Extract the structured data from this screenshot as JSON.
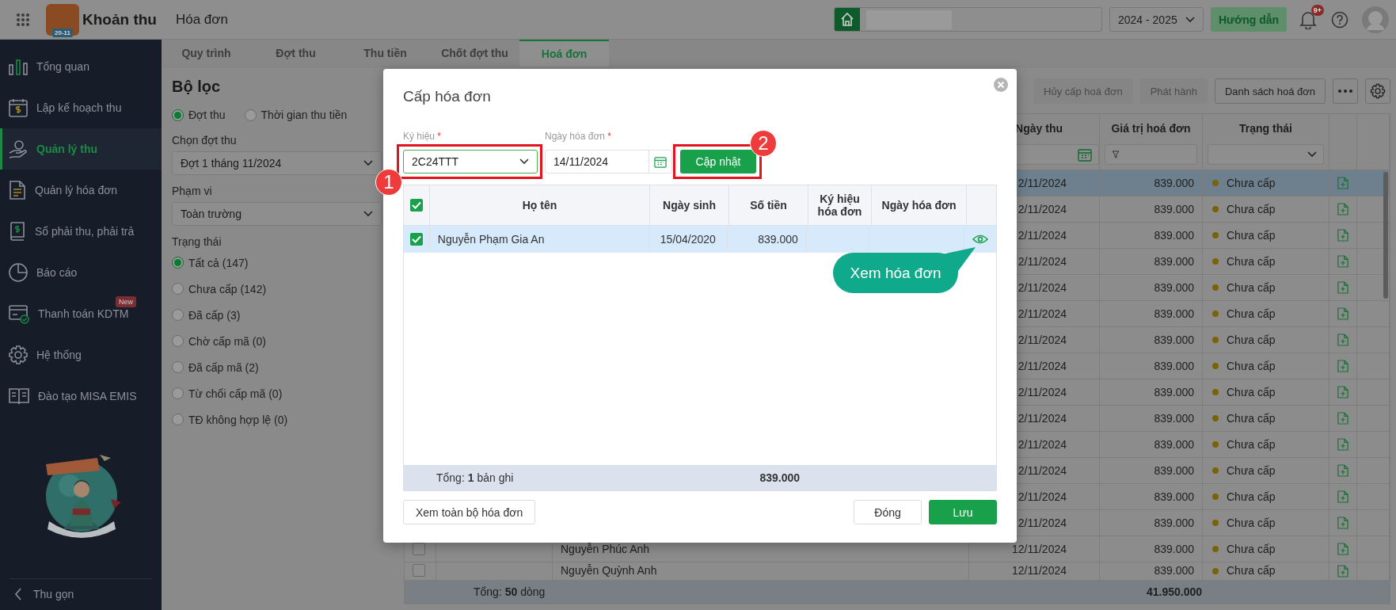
{
  "top_bar": {
    "logo_badge": "20-11",
    "app_name": "Khoản thu",
    "page_title": "Hóa đơn",
    "school_year": "2024 - 2025",
    "guide_button": "Hướng dẫn",
    "notification_badge": "9+"
  },
  "sidebar": {
    "items": [
      {
        "label": "Tổng quan",
        "selected": false
      },
      {
        "label": "Lập kế hoạch thu",
        "selected": false
      },
      {
        "label": "Quản lý thu",
        "selected": true
      },
      {
        "label": "Quản lý hóa đơn",
        "selected": false
      },
      {
        "label": "Sổ phải thu, phải trả",
        "selected": false
      },
      {
        "label": "Báo cáo",
        "selected": false
      },
      {
        "label": "Thanh toán KDTM",
        "selected": false,
        "badge": "New"
      },
      {
        "label": "Hệ thống",
        "selected": false
      },
      {
        "label": "Đào tạo MISA EMIS",
        "selected": false
      }
    ],
    "collapse": "Thu gọn"
  },
  "tabs": [
    {
      "label": "Quy trình",
      "selected": false
    },
    {
      "label": "Đợt thu",
      "selected": false
    },
    {
      "label": "Thu tiền",
      "selected": false
    },
    {
      "label": "Chốt đợt thu",
      "selected": false
    },
    {
      "label": "Hoá đơn",
      "selected": true
    }
  ],
  "filter": {
    "title": "Bộ lọc",
    "mode_options": [
      {
        "label": "Đợt thu",
        "selected": true
      },
      {
        "label": "Thời gian thu tiền",
        "selected": false
      }
    ],
    "period_label": "Chọn đợt thu",
    "period_value": "Đợt 1 tháng 11/2024",
    "scope_label": "Phạm vi",
    "scope_value": "Toàn trường",
    "status_label": "Trạng thái",
    "status_options": [
      {
        "label": "Tất cả (147)",
        "selected": true
      },
      {
        "label": "Chưa cấp (142)",
        "selected": false
      },
      {
        "label": "Đã cấp (3)",
        "selected": false
      },
      {
        "label": "Chờ cấp mã (0)",
        "selected": false
      },
      {
        "label": "Đã cấp mã (2)",
        "selected": false
      },
      {
        "label": "Từ chối cấp mã (0)",
        "selected": false
      },
      {
        "label": "TĐ không hợp lệ (0)",
        "selected": false
      }
    ]
  },
  "toolbar": [
    {
      "label": "Hủy cấp hoá đơn",
      "disabled": true
    },
    {
      "label": "Phát hành",
      "disabled": true
    },
    {
      "label": "Danh sách hoá đơn",
      "disabled": false
    }
  ],
  "table": {
    "columns": [
      "Ngày thu",
      "Giá trị hoá đơn",
      "Trạng thái"
    ],
    "rows": [
      {
        "selected": true,
        "date": "2/11/2024",
        "amount": "839.000",
        "status": "Chưa cấp"
      },
      {
        "selected": false,
        "date": "2/11/2024",
        "amount": "839.000",
        "status": "Chưa cấp"
      },
      {
        "selected": false,
        "date": "2/11/2024",
        "amount": "839.000",
        "status": "Chưa cấp"
      },
      {
        "selected": false,
        "date": "2/11/2024",
        "amount": "839.000",
        "status": "Chưa cấp"
      },
      {
        "selected": false,
        "date": "2/11/2024",
        "amount": "839.000",
        "status": "Chưa cấp"
      },
      {
        "selected": false,
        "date": "2/11/2024",
        "amount": "839.000",
        "status": "Chưa cấp"
      },
      {
        "selected": false,
        "date": "2/11/2024",
        "amount": "839.000",
        "status": "Chưa cấp"
      },
      {
        "selected": false,
        "date": "2/11/2024",
        "amount": "839.000",
        "status": "Chưa cấp"
      },
      {
        "selected": false,
        "date": "2/11/2024",
        "amount": "839.000",
        "status": "Chưa cấp"
      },
      {
        "selected": false,
        "date": "2/11/2024",
        "amount": "839.000",
        "status": "Chưa cấp"
      },
      {
        "selected": false,
        "date": "2/11/2024",
        "amount": "839.000",
        "status": "Chưa cấp"
      },
      {
        "selected": false,
        "date": "2/11/2024",
        "amount": "839.000",
        "status": "Chưa cấp"
      },
      {
        "selected": false,
        "date": "2/11/2024",
        "amount": "839.000",
        "status": "Chưa cấp"
      },
      {
        "selected": false,
        "date": "2/11/2024",
        "amount": "839.000",
        "status": "Chưa cấp"
      },
      {
        "selected": false,
        "checked": false,
        "name": "Nguyễn Phúc Anh",
        "date": "12/11/2024",
        "amount": "839.000",
        "status": "Chưa cấp"
      },
      {
        "selected": false,
        "checked": false,
        "name": "Nguyễn Quỳnh Anh",
        "date": "12/11/2024",
        "amount": "839.000",
        "status": "Chưa cấp"
      }
    ],
    "footer_label": "Tổng: **50** dòng",
    "footer_total": "41.950.000"
  },
  "dialog": {
    "title": "Cấp hóa đơn",
    "symbol_label": {
      "text": "Ký hiệu",
      "mark": "*"
    },
    "symbol_value": "2C24TTT",
    "date_label": {
      "text": "Ngày hóa đơn",
      "mark": "*"
    },
    "date_value": "14/11/2024",
    "update_button": "Cập nhật",
    "columns": [
      "Họ tên",
      "Ngày sinh",
      "Số tiền",
      "Ký hiệu hóa đơn",
      "Ngày hóa đơn"
    ],
    "all_checked": true,
    "rows": [
      {
        "checked": true,
        "selected": true,
        "name": "Nguyễn Phạm Gia An",
        "birth_date": "15/04/2020",
        "amount": "839.000"
      }
    ],
    "total_label": "Tổng: **1** bản ghi",
    "total_amount": "839.000",
    "view_all_button": "Xem toàn bộ hóa đơn",
    "close_button": "Đóng",
    "save_button": "Lưu"
  },
  "callouts": [
    {
      "number": "1"
    },
    {
      "number": "2"
    }
  ],
  "tooltip": "Xem hóa đơn"
}
